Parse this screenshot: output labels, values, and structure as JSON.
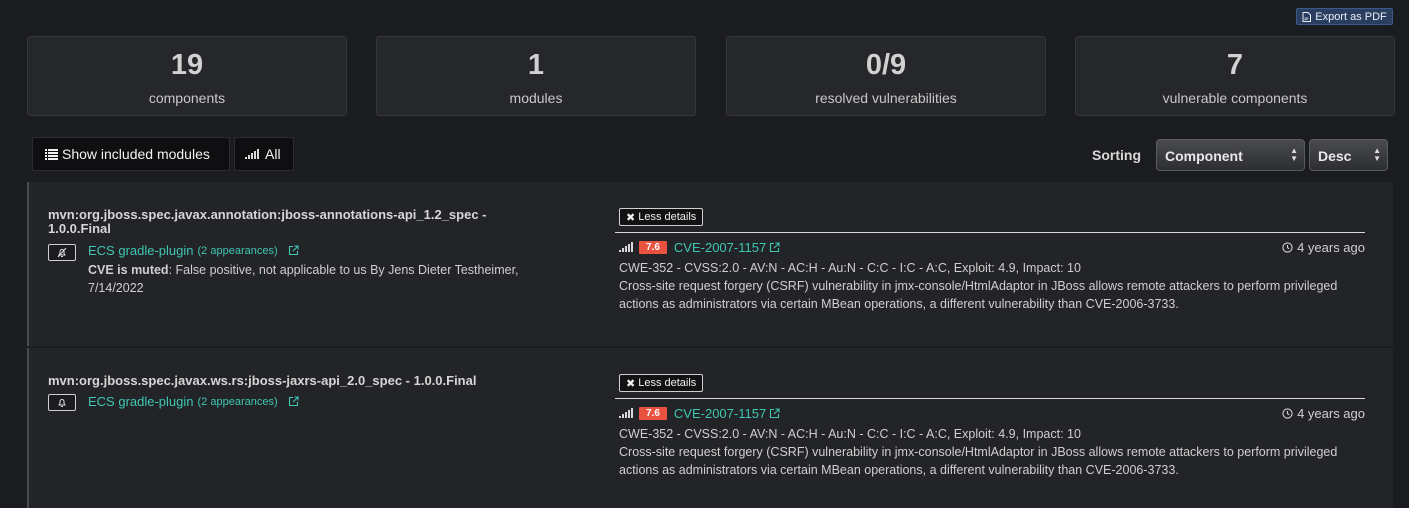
{
  "toolbar": {
    "export_label": "Export as PDF",
    "show_modules_label": "Show included modules",
    "severity_filter_label": "All",
    "sorting_label": "Sorting",
    "sort_field": "Component",
    "sort_order": "Desc"
  },
  "stats": [
    {
      "value": "19",
      "label": "components"
    },
    {
      "value": "1",
      "label": "modules"
    },
    {
      "value": "0/9",
      "label": "resolved vulnerabilities"
    },
    {
      "value": "7",
      "label": "vulnerable components"
    }
  ],
  "components": [
    {
      "name": "mvn:org.jboss.spec.javax.annotation:jboss-annotations-api_1.2_spec - 1.0.0.Final",
      "muted": true,
      "bell_icon": "bell-slash-icon",
      "origin": "ECS gradle-plugin",
      "appearances": "(2 appearances)",
      "muted_label": "CVE is muted",
      "muted_text": ": False positive, not applicable to us By Jens Dieter Testheimer, 7/14/2022",
      "less_details_label": "Less details",
      "vulnerability": {
        "score": "7.6",
        "cve": "CVE-2007-1157",
        "age": "4 years ago",
        "meta": "CWE-352 - CVSS:2.0 - AV:N - AC:H - Au:N - C:C - I:C - A:C, Exploit: 4.9, Impact: 10",
        "description": "Cross-site request forgery (CSRF) vulnerability in jmx-console/HtmlAdaptor in JBoss allows remote attackers to perform privileged actions as administrators via certain MBean operations, a different vulnerability than CVE-2006-3733."
      }
    },
    {
      "name": "mvn:org.jboss.spec.javax.ws.rs:jboss-jaxrs-api_2.0_spec - 1.0.0.Final",
      "muted": false,
      "bell_icon": "bell-icon",
      "origin": "ECS gradle-plugin",
      "appearances": "(2 appearances)",
      "less_details_label": "Less details",
      "vulnerability": {
        "score": "7.6",
        "cve": "CVE-2007-1157",
        "age": "4 years ago",
        "meta": "CWE-352 - CVSS:2.0 - AV:N - AC:H - Au:N - C:C - I:C - A:C, Exploit: 4.9, Impact: 10",
        "description": "Cross-site request forgery (CSRF) vulnerability in jmx-console/HtmlAdaptor in JBoss allows remote attackers to perform privileged actions as administrators via certain MBean operations, a different vulnerability than CVE-2006-3733."
      }
    }
  ],
  "colors": {
    "accent_link": "#3ec7b2",
    "severity_high": "#e8523f",
    "background": "#1b1c1f",
    "card": "#26272a"
  }
}
